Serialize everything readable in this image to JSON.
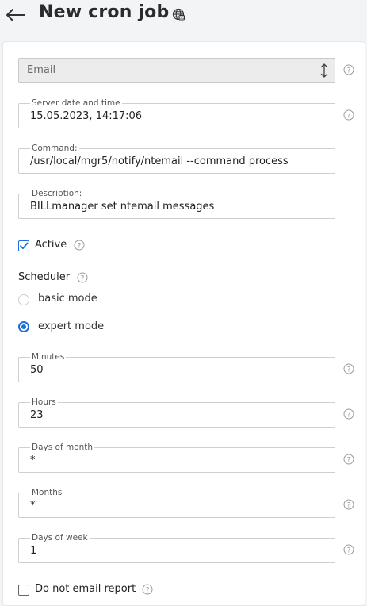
{
  "header": {
    "title": "New cron job",
    "back_icon": "arrow-left-icon",
    "lang_icon": "globe-icon"
  },
  "form": {
    "type_select": {
      "value": "Email"
    },
    "server_time": {
      "label": "Server date and time",
      "value": "15.05.2023, 14:17:06"
    },
    "command": {
      "label": "Command:",
      "value": "/usr/local/mgr5/notify/ntemail --command process"
    },
    "description": {
      "label": "Description:",
      "value": "BILLmanager set ntemail messages"
    },
    "active": {
      "label": "Active",
      "checked": true
    },
    "scheduler": {
      "label": "Scheduler",
      "options": [
        {
          "label": "basic mode",
          "selected": false
        },
        {
          "label": "expert mode",
          "selected": true
        }
      ]
    },
    "minutes": {
      "label": "Minutes",
      "value": "50"
    },
    "hours": {
      "label": "Hours",
      "value": "23"
    },
    "days_of_month": {
      "label": "Days of month",
      "value": "*"
    },
    "months": {
      "label": "Months",
      "value": "*"
    },
    "days_of_week": {
      "label": "Days of week",
      "value": "1"
    },
    "no_email_report": {
      "label": "Do not email report",
      "checked": false
    }
  },
  "colors": {
    "accent": "#1e6fd9",
    "text": "#222222",
    "border": "#cfcfcf"
  }
}
